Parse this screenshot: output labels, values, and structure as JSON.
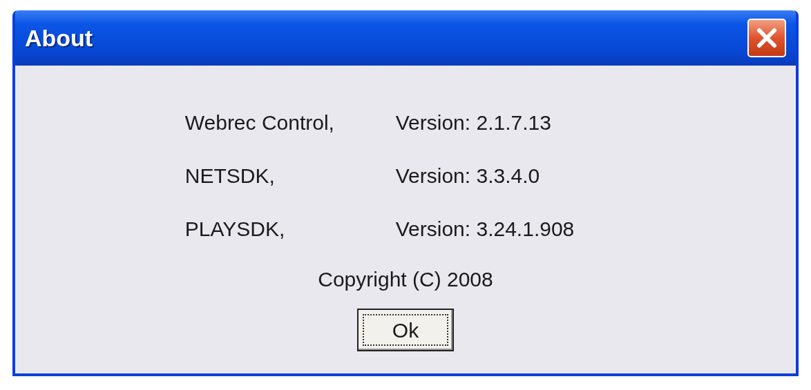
{
  "window": {
    "title": "About"
  },
  "components": [
    {
      "name": "Webrec Control,",
      "version": "Version: 2.1.7.13"
    },
    {
      "name": "NETSDK,",
      "version": "Version: 3.3.4.0"
    },
    {
      "name": "PLAYSDK,",
      "version": "Version: 3.24.1.908"
    }
  ],
  "copyright": "Copyright (C) 2008",
  "buttons": [
    "Ok"
  ]
}
